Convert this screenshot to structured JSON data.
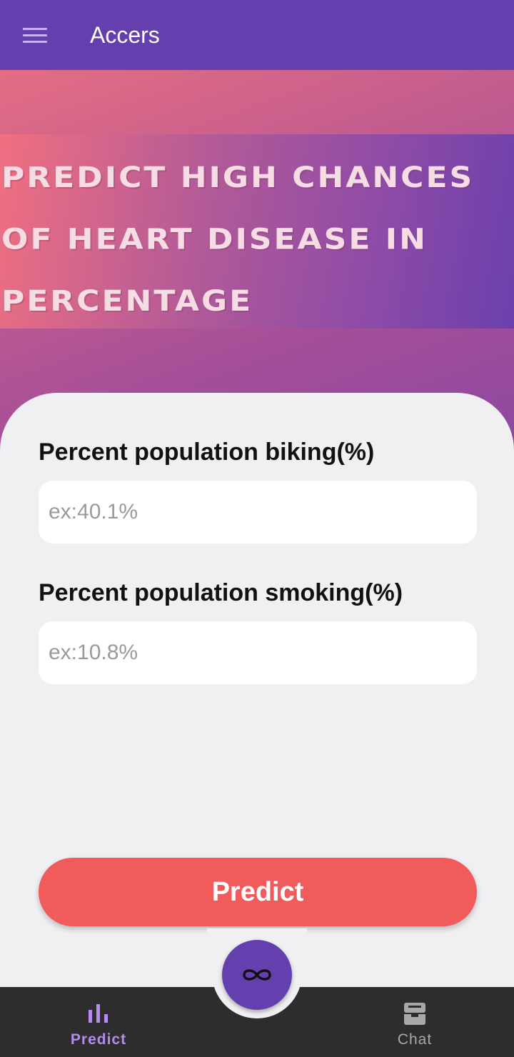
{
  "appbar": {
    "title": "Accers",
    "menu_icon": "hamburger-menu-icon"
  },
  "banner": {
    "text": "Predict high chances of Heart disease in percentage"
  },
  "form": {
    "fields": [
      {
        "label": "Percent population biking(%)",
        "value": "",
        "placeholder": "ex:40.1%"
      },
      {
        "label": "Percent population smoking(%)",
        "value": "",
        "placeholder": "ex:10.8%"
      }
    ],
    "submit_label": "Predict"
  },
  "fab": {
    "icon": "infinity-icon"
  },
  "bottom_nav": {
    "items": [
      {
        "label": "Predict",
        "icon": "bar-chart-icon",
        "active": true
      },
      {
        "label": "Chat",
        "icon": "inbox-tray-icon",
        "active": false
      }
    ]
  },
  "colors": {
    "primary": "#6440ae",
    "accent": "#f25b5c",
    "nav_active": "#b48cf0",
    "nav_background": "#2d2d2d",
    "sheet_background": "#f0f0f3"
  }
}
